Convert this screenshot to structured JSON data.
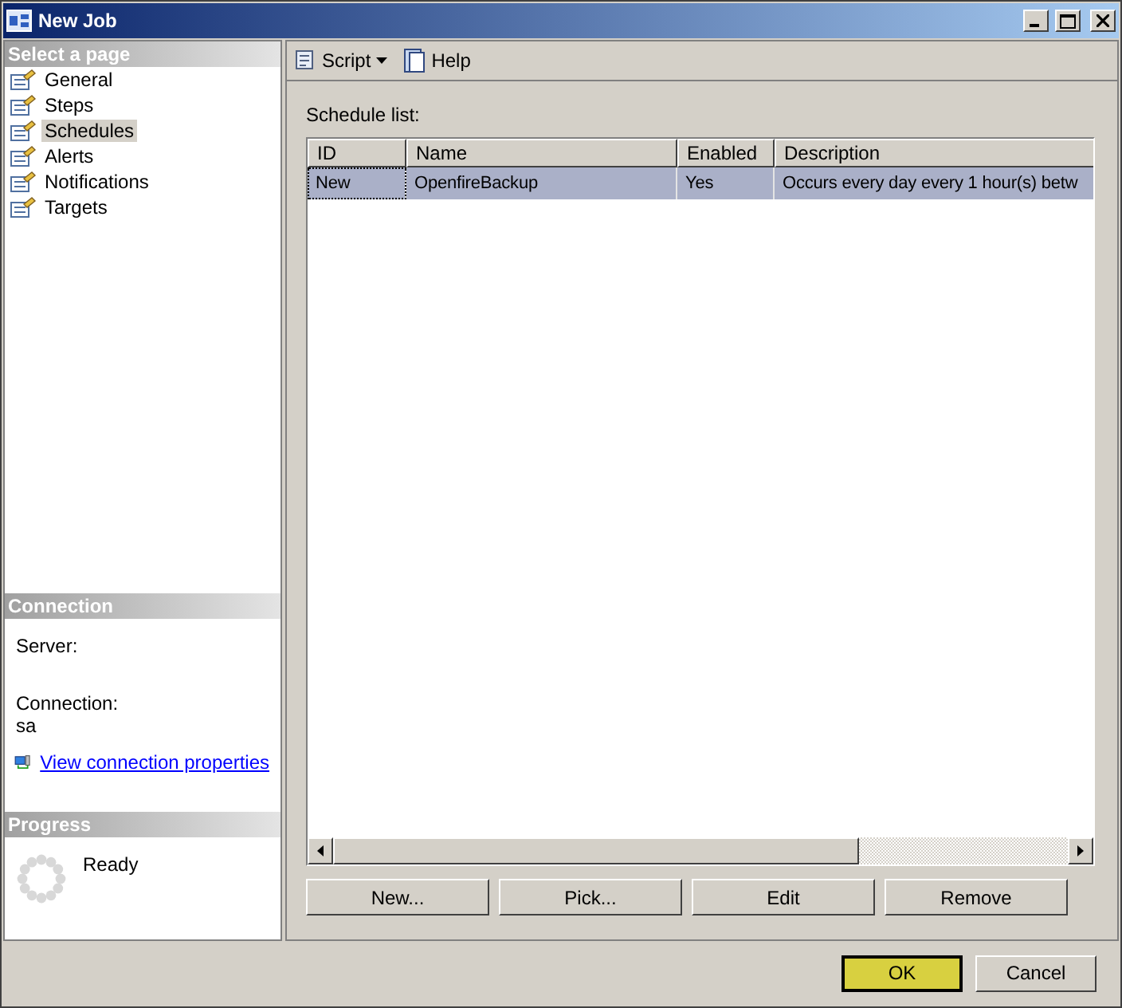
{
  "window": {
    "title": "New Job"
  },
  "select_page": {
    "header": "Select a page",
    "items": [
      {
        "label": "General",
        "selected": false
      },
      {
        "label": "Steps",
        "selected": false
      },
      {
        "label": "Schedules",
        "selected": true
      },
      {
        "label": "Alerts",
        "selected": false
      },
      {
        "label": "Notifications",
        "selected": false
      },
      {
        "label": "Targets",
        "selected": false
      }
    ]
  },
  "connection": {
    "header": "Connection",
    "server_label": "Server:",
    "connection_label": "Connection:",
    "connection_value": "sa",
    "link": "View connection properties"
  },
  "progress": {
    "header": "Progress",
    "status": "Ready"
  },
  "toolbar": {
    "script": "Script",
    "help": "Help"
  },
  "schedule_list": {
    "label": "Schedule list:",
    "columns": [
      "ID",
      "Name",
      "Enabled",
      "Description"
    ],
    "rows": [
      {
        "cells": [
          "New",
          "OpenfireBackup",
          "Yes",
          "Occurs every day every 1 hour(s) betw"
        ],
        "selected": true
      }
    ]
  },
  "list_buttons": [
    "New...",
    "Pick...",
    "Edit",
    "Remove"
  ],
  "dialog_buttons": [
    {
      "label": "OK",
      "default": true
    },
    {
      "label": "Cancel",
      "default": false
    }
  ]
}
